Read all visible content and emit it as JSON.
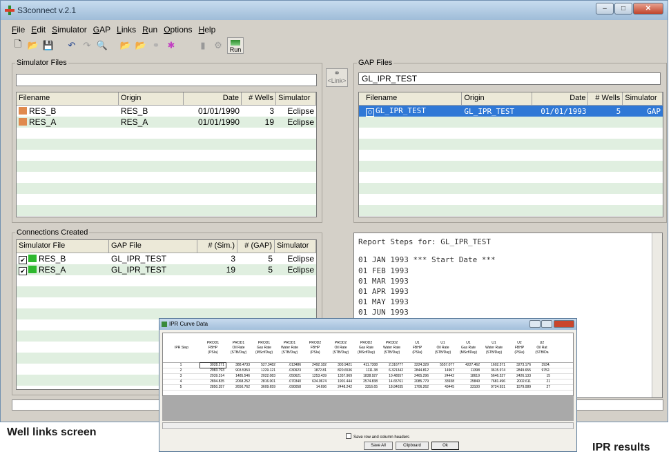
{
  "window": {
    "title": "S3connect v.2.1",
    "min": "–",
    "max": "□",
    "close": "✕"
  },
  "menu": [
    "File",
    "Edit",
    "Simulator",
    "GAP",
    "Links",
    "Run",
    "Options",
    "Help"
  ],
  "toolbar": {
    "run_label": "Run"
  },
  "simulator_files": {
    "legend": "Simulator Files",
    "path": "",
    "columns": [
      "Filename",
      "Origin",
      "Date",
      "# Wells",
      "Simulator"
    ],
    "rows": [
      [
        "RES_B",
        "RES_B",
        "01/01/1990",
        "3",
        "Eclipse"
      ],
      [
        "RES_A",
        "RES_A",
        "01/01/1990",
        "19",
        "Eclipse"
      ]
    ]
  },
  "link_button": {
    "label": "<Link>"
  },
  "gap_files": {
    "legend": "GAP Files",
    "path": "GL_IPR_TEST",
    "columns": [
      "Filename",
      "Origin",
      "Date",
      "# Wells",
      "Simulator"
    ],
    "rows": [
      [
        "GL_IPR_TEST",
        "GL_IPR_TEST",
        "01/01/1993",
        "5",
        "GAP"
      ]
    ]
  },
  "connections": {
    "legend": "Connections Created",
    "columns": [
      "Simulator File",
      "GAP File",
      "# (Sim.)",
      "# (GAP)",
      "Simulator"
    ],
    "rows": [
      [
        "RES_B",
        "GL_IPR_TEST",
        "3",
        "5",
        "Eclipse"
      ],
      [
        "RES_A",
        "GL_IPR_TEST",
        "19",
        "5",
        "Eclipse"
      ]
    ]
  },
  "report": {
    "heading": "Report Steps for: GL_IPR_TEST",
    "lines": [
      "01 JAN 1993 *** Start Date ***",
      "01 FEB 1993",
      "01 MAR 1993",
      "01 APR 1993",
      "01 MAY 1993",
      "01 JUN 1993"
    ]
  },
  "captions": {
    "left": "Well links screen",
    "right": "IPR results"
  },
  "ipr_dialog": {
    "title": "IPR Curve Data",
    "columns": [
      "IPR Step",
      "PROD1\nFBHP\n(PSIa)",
      "PROD1\nOil Rate\n(STB/Day)",
      "PROD1\nGas Rate\n(MScf/Day)",
      "PROD1\nWater Rate\n(STB/Day)",
      "PROD2\nFBHP\n(PSIa)",
      "PROD2\nOil Rate\n(STB/Day)",
      "PROD2\nGas Rate\n(MScf/Day)",
      "PROD2\nWater Rate\n(STB/Day)",
      "U1\nFBHP\n(PSIa)",
      "U1\nOil Rate\n(STB/Day)",
      "U1\nGas Rate\n(MScf/Day)",
      "U1\nWater Rate\n(STB/Day)",
      "U2\nFBHP\n(PSIa)",
      "U2\nOil Rat\n(STB/Da"
    ],
    "rows": [
      [
        "1",
        "3028.271",
        "388.4733",
        "527.3482",
        ".013486",
        "2492.182",
        "303.9421",
        "411.7308",
        "2.316777",
        "3224.329",
        "5557.077",
        "4227.462",
        "1602.571",
        "3273.176",
        "3934."
      ],
      [
        "2",
        "2983.793",
        "903.5353",
        "1229.121",
        ".030923",
        "1872.81",
        "820.6536",
        "1111.38",
        "6.321342",
        "2844.812",
        "14967",
        "11398",
        "3615.974",
        "2849.655",
        "9752."
      ],
      [
        "3",
        "2939.314",
        "1485.546",
        "2022.083",
        ".050621",
        "1253.439",
        "1357.969",
        "1838.927",
        "10.48557",
        "2465.296",
        "24442",
        "18619",
        "5646.527",
        "2426.133",
        "15"
      ],
      [
        "4",
        "2894.835",
        "2068.252",
        "2816.001",
        ".070340",
        "634.0674",
        "1901.444",
        "2574.838",
        "14.65761",
        "2085.779",
        "33938",
        "25849",
        "7681.496",
        "2002.611",
        "21"
      ],
      [
        "5",
        "2850.357",
        "2650.762",
        "3609.659",
        ".090058",
        "14.696",
        "2448.242",
        "3316.65",
        "18.84035",
        "1706.262",
        "43445",
        "33100",
        "9724.931",
        "1579.089",
        "27"
      ]
    ],
    "checkbox_label": "Save row and column headers",
    "buttons": {
      "save_all": "Save All",
      "clipboard": "Clipboard",
      "ok": "Ok"
    }
  }
}
